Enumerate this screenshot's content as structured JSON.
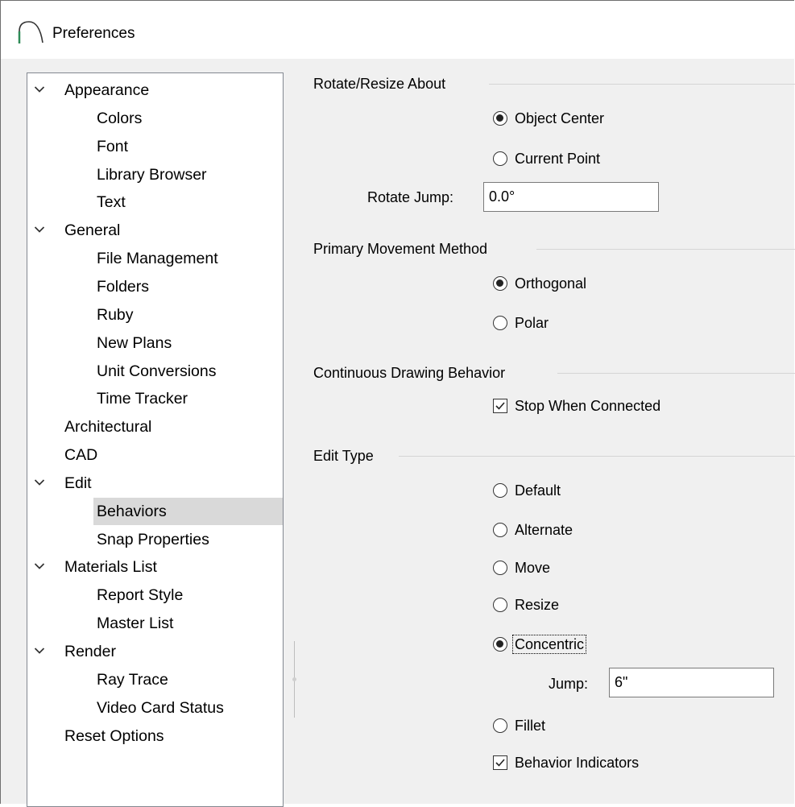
{
  "window": {
    "title": "Preferences"
  },
  "tree": [
    {
      "label": "Appearance",
      "level": 0,
      "expanded": true
    },
    {
      "label": "Colors",
      "level": 1
    },
    {
      "label": "Font",
      "level": 1
    },
    {
      "label": "Library Browser",
      "level": 1
    },
    {
      "label": "Text",
      "level": 1
    },
    {
      "label": "General",
      "level": 0,
      "expanded": true
    },
    {
      "label": "File Management",
      "level": 1
    },
    {
      "label": "Folders",
      "level": 1
    },
    {
      "label": "Ruby",
      "level": 1
    },
    {
      "label": "New Plans",
      "level": 1
    },
    {
      "label": "Unit Conversions",
      "level": 1
    },
    {
      "label": "Time Tracker",
      "level": 1
    },
    {
      "label": "Architectural",
      "level": 0
    },
    {
      "label": "CAD",
      "level": 0
    },
    {
      "label": "Edit",
      "level": 0,
      "expanded": true
    },
    {
      "label": "Behaviors",
      "level": 1,
      "selected": true
    },
    {
      "label": "Snap Properties",
      "level": 1
    },
    {
      "label": "Materials List",
      "level": 0,
      "expanded": true
    },
    {
      "label": "Report Style",
      "level": 1
    },
    {
      "label": "Master List",
      "level": 1
    },
    {
      "label": "Render",
      "level": 0,
      "expanded": true
    },
    {
      "label": "Ray Trace",
      "level": 1
    },
    {
      "label": "Video Card Status",
      "level": 1
    },
    {
      "label": "Reset Options",
      "level": 0
    }
  ],
  "rotate_group": {
    "title": "Rotate/Resize About",
    "options": [
      {
        "label": "Object Center",
        "checked": true
      },
      {
        "label": "Current Point",
        "checked": false
      }
    ],
    "jump_label": "Rotate Jump:",
    "jump_value": "0.0°"
  },
  "movement_group": {
    "title": "Primary Movement Method",
    "options": [
      {
        "label": "Orthogonal",
        "checked": true
      },
      {
        "label": "Polar",
        "checked": false
      }
    ]
  },
  "continuous_group": {
    "title": "Continuous Drawing Behavior",
    "stop_label": "Stop When Connected",
    "stop_checked": true
  },
  "edit_group": {
    "title": "Edit Type",
    "options": [
      {
        "label": "Default",
        "checked": false
      },
      {
        "label": "Alternate",
        "checked": false
      },
      {
        "label": "Move",
        "checked": false
      },
      {
        "label": "Resize",
        "checked": false
      },
      {
        "label": "Concentric",
        "checked": true,
        "focused": true
      }
    ],
    "jump_label": "Jump:",
    "jump_value": "6\"",
    "fillet_label": "Fillet",
    "fillet_checked": false,
    "indicators_label": "Behavior Indicators",
    "indicators_checked": true
  },
  "colors": {
    "selection": "#d9d9d9",
    "panel": "#f0f0f0",
    "border": "#828790"
  },
  "icons": {
    "app": "arch-icon",
    "expand": "chevron-down-icon",
    "check": "check-icon"
  }
}
